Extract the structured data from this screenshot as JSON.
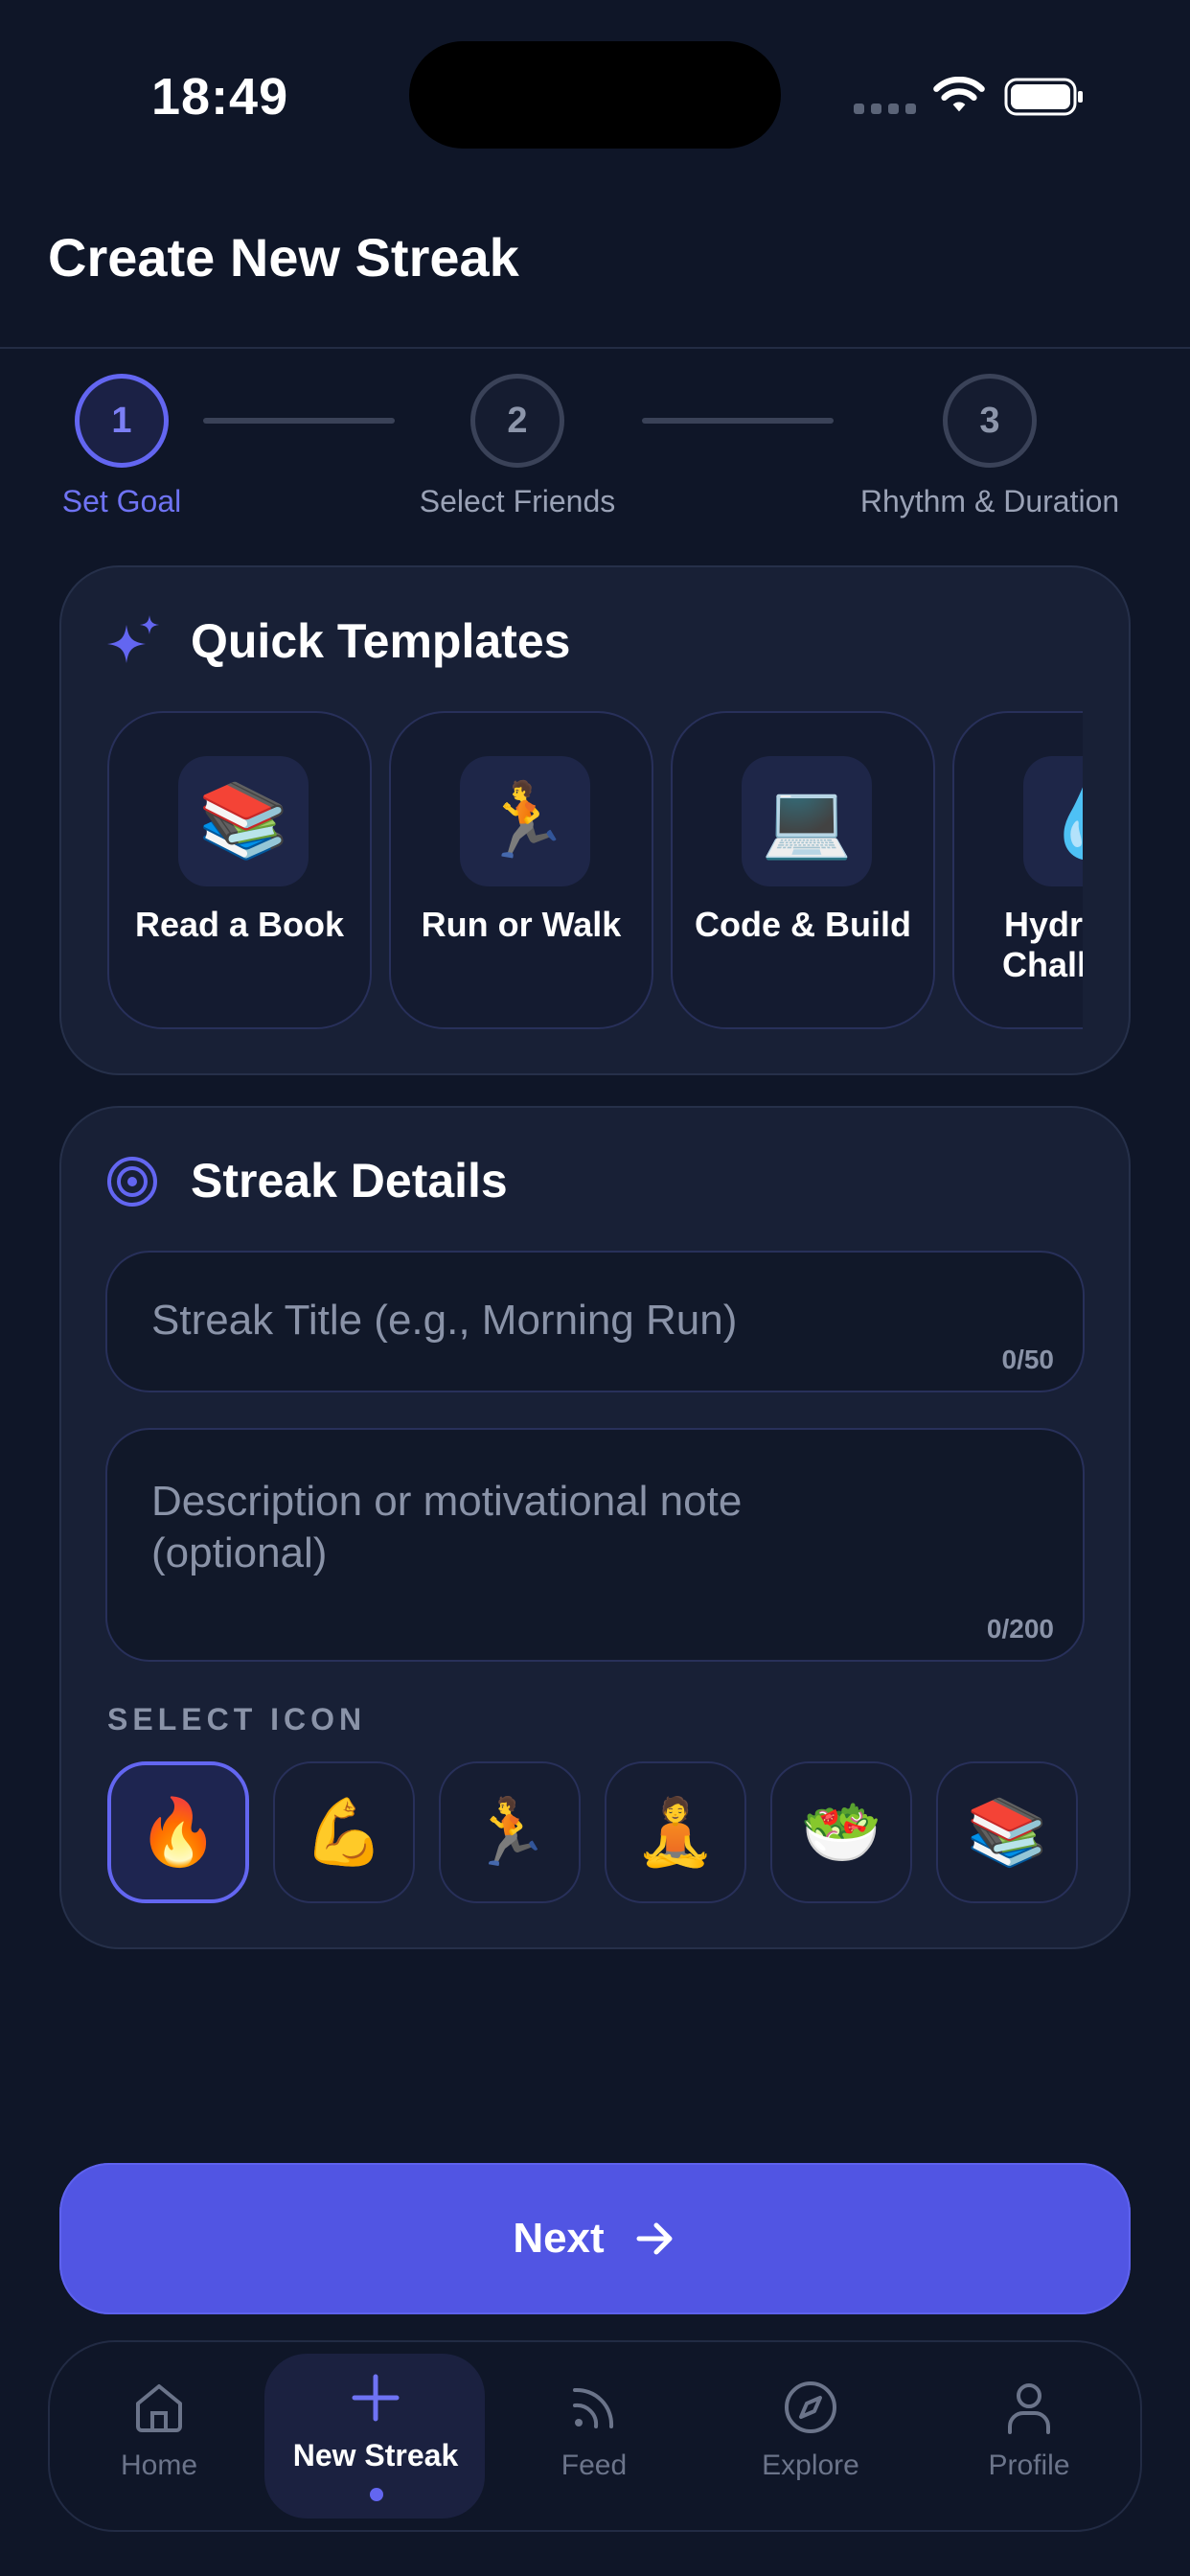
{
  "status_bar": {
    "time": "18:49"
  },
  "header": {
    "title": "Create New Streak"
  },
  "stepper": {
    "steps": [
      {
        "number": "1",
        "label": "Set Goal",
        "active": true
      },
      {
        "number": "2",
        "label": "Select Friends",
        "active": false
      },
      {
        "number": "3",
        "label": "Rhythm & Duration",
        "active": false
      }
    ]
  },
  "quick_templates": {
    "title": "Quick Templates",
    "icon": "sparkles-icon",
    "items": [
      {
        "emoji": "📚",
        "label": "Read a Book"
      },
      {
        "emoji": "🏃",
        "label": "Run or Walk"
      },
      {
        "emoji": "💻",
        "label": "Code & Build"
      },
      {
        "emoji": "💧",
        "label": "Hydration Challenge"
      }
    ]
  },
  "streak_details": {
    "title": "Streak Details",
    "icon": "target-icon",
    "title_field": {
      "placeholder": "Streak Title (e.g., Morning Run)",
      "counter": "0/50"
    },
    "description_field": {
      "placeholder": "Description or motivational note (optional)",
      "counter": "0/200"
    },
    "select_icon_label": "SELECT ICON",
    "icons": [
      "🔥",
      "💪",
      "🏃",
      "🧘",
      "🥗",
      "📚"
    ],
    "selected_icon_index": 0
  },
  "next_button": {
    "label": "Next",
    "icon": "arrow-right-icon"
  },
  "bottom_nav": {
    "items": [
      {
        "label": "Home",
        "icon": "home-icon"
      },
      {
        "label": "New Streak",
        "icon": "plus-icon",
        "active": true
      },
      {
        "label": "Feed",
        "icon": "rss-icon"
      },
      {
        "label": "Explore",
        "icon": "compass-icon"
      },
      {
        "label": "Profile",
        "icon": "user-icon"
      }
    ]
  },
  "colors": {
    "background": "#0f1628",
    "accent": "#6366f1",
    "button": "#5155e3",
    "card": "#182036"
  }
}
